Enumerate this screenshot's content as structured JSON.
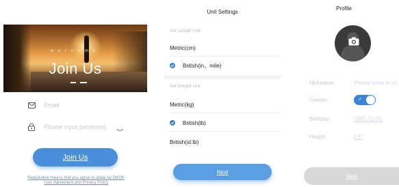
{
  "join_screen": {
    "welcome_text": "welcome",
    "title": "Join Us",
    "email_placeholder": "Email",
    "password_placeholder": "Please input password",
    "join_button": "Join Us",
    "terms_line1": "Registration means that you agree to abide by OKOK",
    "terms_line2": "User Agreement and Privacy Policy"
  },
  "unit_settings": {
    "title": "Unit Settings",
    "length_label": "Set Length Unit",
    "length_options": [
      {
        "label": "Metric(cm)",
        "selected": false
      },
      {
        "label": "British(in、mile)",
        "selected": true
      }
    ],
    "weight_label": "Set Weight Unit",
    "weight_options": [
      {
        "label": "Metric(kg)",
        "selected": false
      },
      {
        "label": "British(lb)",
        "selected": true
      },
      {
        "label": "British(st:lb)",
        "selected": false
      }
    ],
    "next_button": "Next"
  },
  "profile": {
    "title": "Profile",
    "nickname_label": "Nickname:",
    "nickname_placeholder": "Please enter a nic",
    "gender_label": "Gender:",
    "gender_toggle_on": true,
    "birthday_label": "Birthday:",
    "birthday_value": "1991-01-01",
    "height_label": "Height:",
    "height_value": "5'6\"",
    "next_button": "Next"
  },
  "colors": {
    "accent_blue": "#4a8fd9",
    "toggle_blue": "#3c83d6",
    "disabled_gray": "#d8d8d8"
  }
}
